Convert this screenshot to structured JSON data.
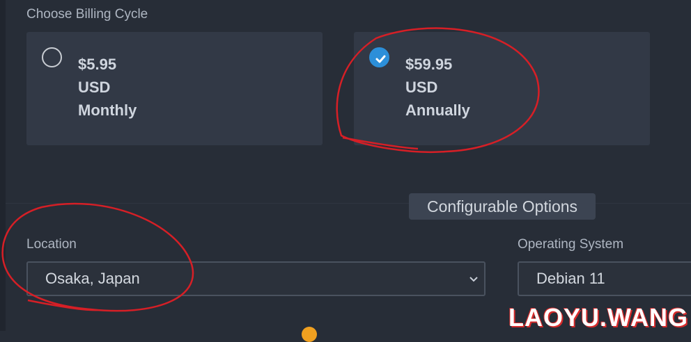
{
  "billing": {
    "label": "Choose Billing Cycle",
    "options": [
      {
        "price": "$5.95",
        "currency": "USD",
        "cycle": "Monthly",
        "selected": false
      },
      {
        "price": "$59.95",
        "currency": "USD",
        "cycle": "Annually",
        "selected": true
      }
    ]
  },
  "config": {
    "header": "Configurable Options",
    "location": {
      "label": "Location",
      "value": "Osaka, Japan"
    },
    "os": {
      "label": "Operating System",
      "value": "Debian 11"
    }
  },
  "watermark": "LAOYU.WANG",
  "colors": {
    "background": "#272d37",
    "card": "#323946",
    "accent": "#2c8fd9",
    "annotation": "#d61f26"
  }
}
